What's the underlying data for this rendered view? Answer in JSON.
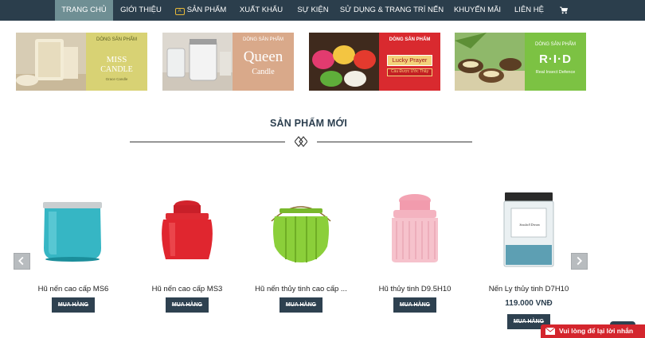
{
  "nav": {
    "items": [
      "TRANG CHỦ",
      "GIỚI THIỆU",
      "SẢN PHẨM",
      "XUẤT KHẨU",
      "SỰ KIỆN",
      "SỬ DỤNG & TRANG TRÍ NẾN",
      "KHUYẾN MÃI",
      "LIÊN HỆ"
    ],
    "badge_text": "A",
    "cart_icon": "shopping-cart-icon",
    "bg_color": "#2b3e4c",
    "active_color": "#6f8f94"
  },
  "banners": [
    {
      "line1": "DÒNG SẢN PHẨM",
      "line2": "MISS",
      "line3": "CANDLE",
      "line4": "Grace Candle",
      "panel_color": "#d8d274",
      "text_color": "#ffffff"
    },
    {
      "line1": "DÒNG SẢN PHẨM",
      "line2": "Queen",
      "line3": "Candle",
      "panel_color": "#d9a98a",
      "text_color": "#ffffff"
    },
    {
      "line1": "DÒNG SẢN PHẨM",
      "line2": "Lucky Prayer",
      "line3": "Cầu Được Ước Thấy",
      "panel_color": "#d92a2f",
      "text_color": "#ffffff"
    },
    {
      "line1": "DÒNG SẢN PHẨM",
      "line2": "R·I·D",
      "line3": "Real Insect Defence",
      "panel_color": "#7cc243",
      "text_color": "#ffffff"
    }
  ],
  "section": {
    "title": "SẢN PHẨM MỚI",
    "divider_icon": "diamond-ornament-icon"
  },
  "products": [
    {
      "name": "Hũ nến cao cấp MS6",
      "price": "",
      "button": "MUA HÀNG"
    },
    {
      "name": "Hũ nến cao cấp MS3",
      "price": "",
      "button": "MUA HÀNG"
    },
    {
      "name": "Hũ nến thủy tinh cao cấp ...",
      "price": "",
      "button": "MUA HÀNG"
    },
    {
      "name": "Hũ thủy tinh D9.5H10",
      "price": "",
      "button": "MUA HÀNG"
    },
    {
      "name": "Nến Ly thủy tinh D7H10",
      "price": "119.000 VNĐ",
      "button": "MUA HÀNG"
    }
  ],
  "product_label": {
    "text": "Seashell Dream"
  },
  "carousel": {
    "prev_icon": "chevron-left-icon",
    "next_icon": "chevron-right-icon"
  },
  "chat": {
    "label": "Vui lòng để lại lời nhắn",
    "icon": "envelope-icon",
    "color": "#d4252d"
  }
}
